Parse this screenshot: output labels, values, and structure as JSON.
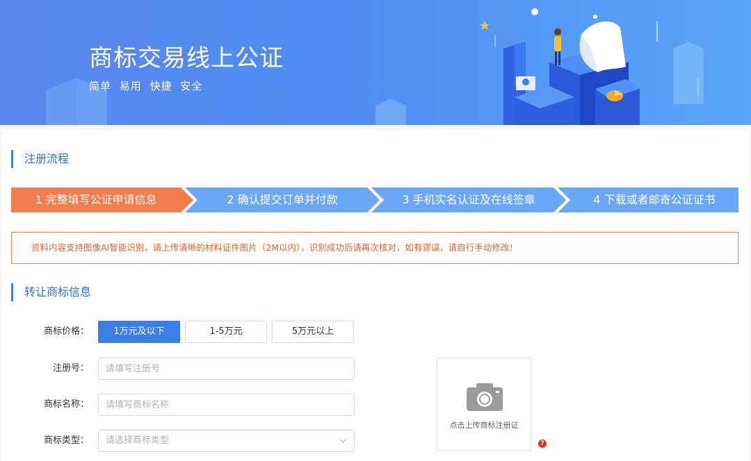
{
  "banner": {
    "title": "商标交易线上公证",
    "tags": [
      "简单",
      "易用",
      "快捷",
      "安全"
    ]
  },
  "flow": {
    "title": "注册流程",
    "steps": [
      "1 完整填写公证申请信息",
      "2 确认提交订单并付款",
      "3 手机实名认证及在线签章",
      "4 下载或者邮寄公证证书"
    ],
    "active_step": 1
  },
  "notice": "资料内容支持图像AI智能识别，请上传清晰的材料证件图片（2M以内），识别成功后请再次核对，如有谬误，请自行手动修改！",
  "transfer": {
    "title": "转让商标信息",
    "price_label": "商标价格：",
    "price_options": [
      "1万元及以下",
      "1-5万元",
      "5万元以上"
    ],
    "price_selected": 0,
    "reg_no_label": "注册号：",
    "reg_no_placeholder": "请填写注册号",
    "name_label": "商标名称：",
    "name_placeholder": "请填写商标名称",
    "type_label": "商标类型：",
    "type_placeholder": "请选择商标类型",
    "upload_text": "点击上传商标注册证",
    "help_icon": "?"
  },
  "colors": {
    "accent": "#3a7ee6",
    "active_step": "#f27d4f",
    "step": "#6aa7f7",
    "notice": "#e9602d"
  }
}
